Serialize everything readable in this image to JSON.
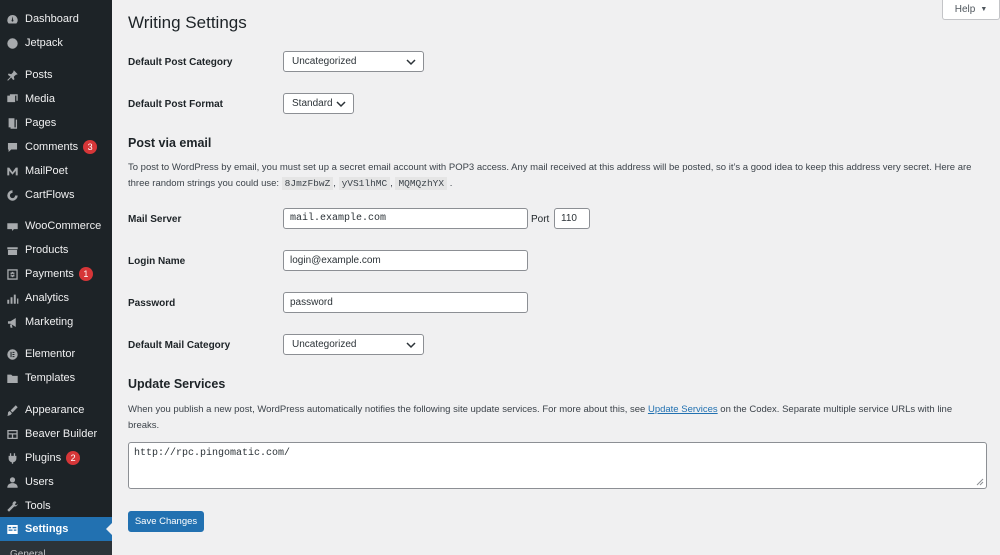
{
  "sidebar": {
    "items": [
      {
        "label": "Dashboard",
        "icon": "dashboard-icon",
        "badge": ""
      },
      {
        "label": "Jetpack",
        "icon": "jetpack-icon",
        "badge": ""
      },
      {
        "label": "Posts",
        "icon": "pin-icon",
        "badge": ""
      },
      {
        "label": "Media",
        "icon": "media-icon",
        "badge": ""
      },
      {
        "label": "Pages",
        "icon": "pages-icon",
        "badge": ""
      },
      {
        "label": "Comments",
        "icon": "comments-icon",
        "badge": "3"
      },
      {
        "label": "MailPoet",
        "icon": "mailpoet-icon",
        "badge": ""
      },
      {
        "label": "CartFlows",
        "icon": "cartflows-icon",
        "badge": ""
      },
      {
        "label": "WooCommerce",
        "icon": "woocommerce-icon",
        "badge": ""
      },
      {
        "label": "Products",
        "icon": "products-icon",
        "badge": ""
      },
      {
        "label": "Payments",
        "icon": "payments-icon",
        "badge": "1"
      },
      {
        "label": "Analytics",
        "icon": "analytics-icon",
        "badge": ""
      },
      {
        "label": "Marketing",
        "icon": "marketing-icon",
        "badge": ""
      },
      {
        "label": "Elementor",
        "icon": "elementor-icon",
        "badge": ""
      },
      {
        "label": "Templates",
        "icon": "templates-icon",
        "badge": ""
      },
      {
        "label": "Appearance",
        "icon": "appearance-icon",
        "badge": ""
      },
      {
        "label": "Beaver Builder",
        "icon": "beaver-builder-icon",
        "badge": ""
      },
      {
        "label": "Plugins",
        "icon": "plugins-icon",
        "badge": "2"
      },
      {
        "label": "Users",
        "icon": "users-icon",
        "badge": ""
      },
      {
        "label": "Tools",
        "icon": "tools-icon",
        "badge": ""
      },
      {
        "label": "Settings",
        "icon": "settings-icon",
        "badge": ""
      }
    ],
    "submenu_peek": "General"
  },
  "help": {
    "label": "Help",
    "caret": "▼"
  },
  "page": {
    "title": "Writing Settings"
  },
  "fields": {
    "default_post_category": {
      "label": "Default Post Category",
      "value": "Uncategorized"
    },
    "default_post_format": {
      "label": "Default Post Format",
      "value": "Standard"
    }
  },
  "post_via_email": {
    "title": "Post via email",
    "desc_line1": "To post to WordPress by email, you must set up a secret email account with POP3 access. Any mail received at this address will be posted, so it’s a good idea to keep this address very secret. Here are",
    "desc_line2_prefix": "three random strings you could use:",
    "codes": [
      "8JmzFbwZ",
      "yVS1lhMC",
      "MQMQzhYX"
    ],
    "sep": ",",
    "end": ".",
    "mail_server": {
      "label": "Mail Server",
      "value": "mail.example.com"
    },
    "port": {
      "label": "Port",
      "value": "110"
    },
    "login_name": {
      "label": "Login Name",
      "value": "login@example.com"
    },
    "password": {
      "label": "Password",
      "value": "password"
    },
    "default_mail_category": {
      "label": "Default Mail Category",
      "value": "Uncategorized"
    }
  },
  "update_services": {
    "title": "Update Services",
    "desc_before": "When you publish a new post, WordPress automatically notifies the following site update services. For more about this, see",
    "link": "Update Services",
    "desc_after": "on the Codex. Separate multiple service URLs with line",
    "desc_line2": "breaks.",
    "services": "http://rpc.pingomatic.com/"
  },
  "save_button": {
    "label": "Save Changes"
  },
  "colors": {
    "accent": "#2271b1",
    "sidebar_bg": "#1d2327",
    "badge": "#d63638",
    "page_bg": "#f0f0f1"
  }
}
